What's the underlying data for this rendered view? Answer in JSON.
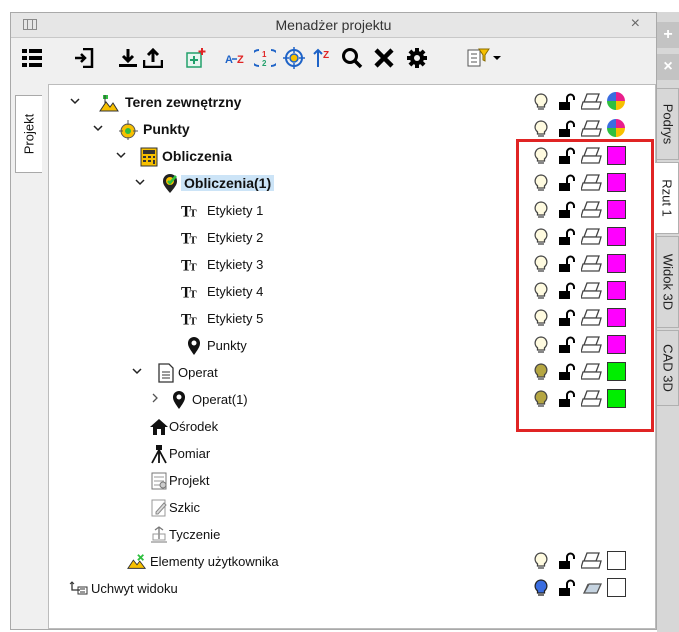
{
  "window": {
    "title": "Menadżer projektu",
    "close_glyph": "×"
  },
  "left_tab": {
    "label": "Projekt"
  },
  "right_strip": {
    "buttons": [
      "+",
      "×"
    ],
    "tabs": [
      {
        "label": "Podrys",
        "active": false
      },
      {
        "label": "Rzut 1",
        "active": true
      },
      {
        "label": "Widok 3D",
        "active": false
      },
      {
        "label": "CAD 3D",
        "active": false
      }
    ]
  },
  "toolbar": {
    "items": [
      "list-icon",
      "import-icon",
      "download-icon",
      "upload-icon",
      "add-layer-icon",
      "sort-az-icon",
      "sort-numeric-icon",
      "target-icon",
      "sort-up-icon",
      "search-icon",
      "delete-icon",
      "settings-icon",
      "filter-dropdown-icon"
    ]
  },
  "tree": [
    {
      "label": "Teren zewnętrzny",
      "bold": true,
      "icon": "terrain-icon",
      "expander": "open",
      "status": {
        "bulb": "yellow",
        "color": "multicolor"
      }
    },
    {
      "label": "Punkty",
      "bold": true,
      "icon": "points-target-icon",
      "expander": "open",
      "status": {
        "bulb": "yellow",
        "color": "multicolor"
      }
    },
    {
      "label": "Obliczenia",
      "bold": true,
      "icon": "calculator-icon",
      "expander": "open",
      "status": {
        "bulb": "yellow",
        "color": "#ff00ff"
      }
    },
    {
      "label": "Obliczenia(1)",
      "bold": true,
      "selected": true,
      "icon": "check-pin-icon",
      "expander": "open",
      "status": {
        "bulb": "yellow",
        "color": "#ff00ff"
      }
    },
    {
      "label": "Etykiety 1",
      "icon": "text-tt-icon",
      "status": {
        "bulb": "yellow",
        "color": "#ff00ff"
      }
    },
    {
      "label": "Etykiety 2",
      "icon": "text-tt-icon",
      "status": {
        "bulb": "yellow",
        "color": "#ff00ff"
      }
    },
    {
      "label": "Etykiety 3",
      "icon": "text-tt-icon",
      "status": {
        "bulb": "yellow",
        "color": "#ff00ff"
      }
    },
    {
      "label": "Etykiety 4",
      "icon": "text-tt-icon",
      "status": {
        "bulb": "yellow",
        "color": "#ff00ff"
      }
    },
    {
      "label": "Etykiety 5",
      "icon": "text-tt-icon",
      "status": {
        "bulb": "yellow",
        "color": "#ff00ff"
      }
    },
    {
      "label": "Punkty",
      "icon": "map-pin-icon",
      "status": {
        "bulb": "yellow",
        "color": "#ff00ff"
      }
    },
    {
      "label": "Operat",
      "icon": "document-icon",
      "expander": "open",
      "status": {
        "bulb": "olive",
        "color": "#00ee00"
      }
    },
    {
      "label": "Operat(1)",
      "icon": "map-pin-icon",
      "expander": "closed",
      "status": {
        "bulb": "olive",
        "color": "#00ee00"
      }
    },
    {
      "label": "Ośrodek",
      "icon": "house-icon"
    },
    {
      "label": "Pomiar",
      "icon": "tripod-icon"
    },
    {
      "label": "Projekt",
      "icon": "project-icon"
    },
    {
      "label": "Szkic",
      "icon": "sketch-icon"
    },
    {
      "label": "Tyczenie",
      "icon": "staking-icon"
    },
    {
      "label": "Elementy użytkownika",
      "icon": "user-elements-icon",
      "status": {
        "bulb": "yellow",
        "color": "#ffffff"
      }
    },
    {
      "label": "Uchwyt widoku",
      "icon": "view-handle-icon",
      "status": {
        "bulb": "blue",
        "color": "#ffffff",
        "printer": "eraser"
      }
    }
  ],
  "colors": {
    "highlight_border": "#e02424",
    "selection": "#cce4f7"
  }
}
